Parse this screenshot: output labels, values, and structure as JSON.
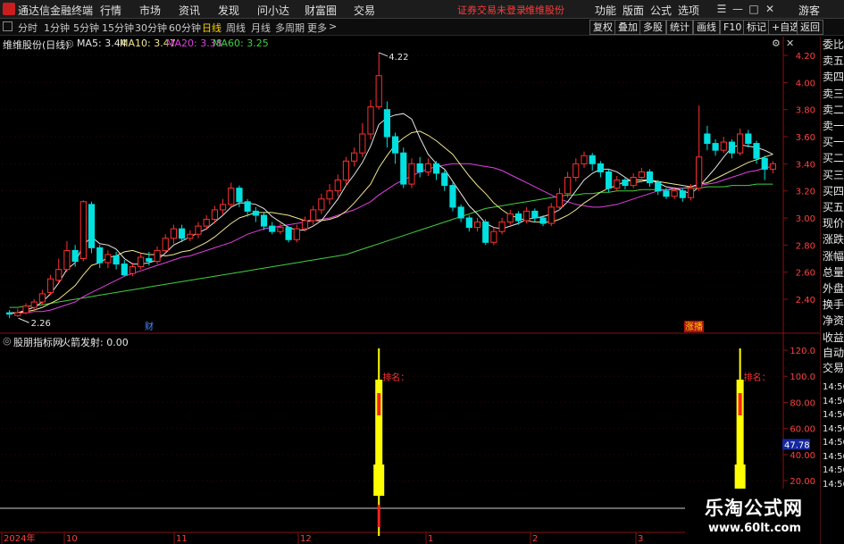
{
  "app": {
    "title": "通达信金融终端",
    "menu": [
      "行情",
      "市场",
      "资讯",
      "发现",
      "问小达",
      "财富圈",
      "交易"
    ],
    "status_text": "证券交易未登录",
    "stock_name": "维维股份",
    "right_menu": [
      "功能",
      "版面",
      "公式",
      "选项"
    ],
    "guest": "游客"
  },
  "toolbar": {
    "periods": [
      "分时",
      "1分钟",
      "5分钟",
      "15分钟",
      "30分钟",
      "60分钟",
      "日线",
      "周线",
      "月线",
      "多周期",
      "更多"
    ],
    "active_period": "日线",
    "right_buttons": [
      "复权",
      "叠加",
      "多股",
      "统计",
      "画线",
      "F10",
      "标记",
      "+自选",
      "返回"
    ]
  },
  "main_chart": {
    "title": "维维股份(日线)",
    "ma": [
      {
        "label": "MA5: 3.44",
        "color": "#e6e6e6"
      },
      {
        "label": "MA10: 3.47",
        "color": "#f0e68c"
      },
      {
        "label": "MA20: 3.38",
        "color": "#e040e0"
      },
      {
        "label": "MA60: 3.25",
        "color": "#40d040"
      }
    ],
    "high_label": "4.22",
    "low_label": "2.26",
    "y_ticks": [
      "4.20",
      "4.00",
      "3.80",
      "3.60",
      "3.40",
      "3.20",
      "3.00",
      "2.80",
      "2.60",
      "2.40"
    ],
    "markers": [
      "财",
      "涨播"
    ]
  },
  "sub_chart": {
    "title": "股朋指标网",
    "indicator": "火箭发射: 0.00",
    "label": "排名：",
    "y_ticks": [
      "120.0",
      "100.0",
      "80.00",
      "60.00",
      "40.00",
      "20.00"
    ],
    "current_value": "47.78"
  },
  "x_axis": [
    "2024年",
    "10",
    "11",
    "12",
    "1",
    "2",
    "3"
  ],
  "right_panel": [
    "委比",
    "卖五",
    "卖四",
    "卖三",
    "卖二",
    "卖一",
    "买一",
    "买二",
    "买三",
    "买四",
    "买五",
    "现价",
    "涨跌",
    "涨幅",
    "总量",
    "外盘",
    "换手",
    "净资",
    "收益",
    "自动",
    "交易",
    "14:56",
    "14:56",
    "14:56",
    "14:56",
    "14:56",
    "14:56",
    "14:56",
    "14:56"
  ],
  "watermark": {
    "title": "乐淘公式网",
    "url": "www.60lt.com"
  },
  "colors": {
    "up": "#ff3030",
    "down": "#00e0e0",
    "ma5": "#e6e6e6",
    "ma10": "#f0e68c",
    "ma20": "#e040e0",
    "ma60": "#40d040",
    "rocket": "#ffff00"
  },
  "chart_data": {
    "type": "candlestick",
    "y_range": [
      2.2,
      4.3
    ],
    "candles": [
      [
        2.3,
        2.29,
        2.32,
        2.26
      ],
      [
        2.28,
        2.3,
        2.33,
        2.27
      ],
      [
        2.3,
        2.35,
        2.37,
        2.29
      ],
      [
        2.34,
        2.38,
        2.4,
        2.32
      ],
      [
        2.38,
        2.44,
        2.47,
        2.36
      ],
      [
        2.45,
        2.55,
        2.58,
        2.43
      ],
      [
        2.54,
        2.62,
        2.7,
        2.52
      ],
      [
        2.62,
        2.76,
        2.83,
        2.6
      ],
      [
        2.76,
        2.68,
        2.8,
        2.64
      ],
      [
        2.7,
        3.12,
        3.13,
        2.68
      ],
      [
        3.1,
        2.78,
        3.12,
        2.74
      ],
      [
        2.78,
        2.67,
        2.8,
        2.63
      ],
      [
        2.67,
        2.73,
        2.76,
        2.63
      ],
      [
        2.72,
        2.66,
        2.75,
        2.62
      ],
      [
        2.66,
        2.58,
        2.69,
        2.57
      ],
      [
        2.59,
        2.64,
        2.67,
        2.57
      ],
      [
        2.64,
        2.71,
        2.74,
        2.62
      ],
      [
        2.7,
        2.68,
        2.75,
        2.65
      ],
      [
        2.68,
        2.76,
        2.79,
        2.66
      ],
      [
        2.76,
        2.85,
        2.88,
        2.74
      ],
      [
        2.85,
        2.92,
        2.95,
        2.81
      ],
      [
        2.92,
        2.85,
        2.95,
        2.82
      ],
      [
        2.85,
        2.88,
        2.91,
        2.83
      ],
      [
        2.88,
        2.94,
        2.97,
        2.85
      ],
      [
        2.94,
        2.99,
        3.02,
        2.91
      ],
      [
        2.99,
        3.06,
        3.09,
        2.96
      ],
      [
        3.06,
        3.1,
        3.14,
        3.02
      ],
      [
        3.1,
        3.22,
        3.26,
        3.08
      ],
      [
        3.22,
        3.12,
        3.24,
        3.08
      ],
      [
        3.12,
        3.05,
        3.14,
        3.01
      ],
      [
        3.05,
        3.02,
        3.08,
        2.97
      ],
      [
        3.02,
        2.94,
        3.04,
        2.91
      ],
      [
        2.94,
        2.9,
        2.97,
        2.88
      ],
      [
        2.9,
        2.93,
        2.96,
        2.88
      ],
      [
        2.93,
        2.84,
        2.94,
        2.82
      ],
      [
        2.84,
        2.92,
        2.95,
        2.82
      ],
      [
        2.92,
        2.98,
        3.01,
        2.9
      ],
      [
        2.98,
        3.06,
        3.09,
        2.95
      ],
      [
        3.06,
        3.14,
        3.18,
        3.03
      ],
      [
        3.14,
        3.2,
        3.25,
        3.1
      ],
      [
        3.2,
        3.28,
        3.32,
        3.16
      ],
      [
        3.28,
        3.42,
        3.45,
        3.24
      ],
      [
        3.42,
        3.48,
        3.52,
        3.38
      ],
      [
        3.48,
        3.62,
        3.7,
        3.45
      ],
      [
        3.62,
        3.82,
        3.87,
        3.58
      ],
      [
        3.82,
        4.05,
        4.22,
        3.8
      ],
      [
        3.8,
        3.6,
        3.86,
        3.52
      ],
      [
        3.6,
        3.48,
        3.63,
        3.4
      ],
      [
        3.48,
        3.25,
        3.52,
        3.22
      ],
      [
        3.25,
        3.4,
        3.44,
        3.22
      ],
      [
        3.4,
        3.34,
        3.45,
        3.3
      ],
      [
        3.34,
        3.4,
        3.44,
        3.31
      ],
      [
        3.4,
        3.33,
        3.42,
        3.28
      ],
      [
        3.33,
        3.24,
        3.35,
        3.2
      ],
      [
        3.24,
        3.08,
        3.26,
        3.05
      ],
      [
        3.08,
        3.0,
        3.1,
        2.97
      ],
      [
        3.0,
        2.93,
        3.02,
        2.9
      ],
      [
        2.93,
        2.97,
        3.0,
        2.9
      ],
      [
        2.97,
        2.82,
        2.99,
        2.8
      ],
      [
        2.82,
        2.9,
        2.93,
        2.8
      ],
      [
        2.9,
        2.97,
        3.0,
        2.88
      ],
      [
        2.97,
        3.03,
        3.06,
        2.95
      ],
      [
        3.03,
        2.98,
        3.05,
        2.95
      ],
      [
        2.98,
        3.05,
        3.08,
        2.96
      ],
      [
        3.05,
        3.0,
        3.07,
        2.97
      ],
      [
        3.0,
        2.96,
        3.02,
        2.94
      ],
      [
        2.96,
        3.08,
        3.11,
        2.94
      ],
      [
        3.08,
        3.18,
        3.22,
        3.06
      ],
      [
        3.18,
        3.3,
        3.34,
        3.15
      ],
      [
        3.3,
        3.4,
        3.44,
        3.27
      ],
      [
        3.4,
        3.46,
        3.49,
        3.37
      ],
      [
        3.46,
        3.4,
        3.48,
        3.35
      ],
      [
        3.4,
        3.34,
        3.42,
        3.3
      ],
      [
        3.34,
        3.22,
        3.36,
        3.19
      ],
      [
        3.22,
        3.28,
        3.31,
        3.2
      ],
      [
        3.28,
        3.24,
        3.3,
        3.21
      ],
      [
        3.24,
        3.3,
        3.33,
        3.22
      ],
      [
        3.3,
        3.34,
        3.37,
        3.27
      ],
      [
        3.34,
        3.26,
        3.36,
        3.23
      ],
      [
        3.26,
        3.2,
        3.28,
        3.17
      ],
      [
        3.2,
        3.16,
        3.22,
        3.14
      ],
      [
        3.16,
        3.2,
        3.23,
        3.14
      ],
      [
        3.2,
        3.15,
        3.22,
        3.12
      ],
      [
        3.15,
        3.22,
        3.25,
        3.13
      ],
      [
        3.22,
        3.45,
        3.83,
        3.2
      ],
      [
        3.62,
        3.55,
        3.68,
        3.5
      ],
      [
        3.55,
        3.5,
        3.58,
        3.46
      ],
      [
        3.5,
        3.56,
        3.6,
        3.48
      ],
      [
        3.56,
        3.48,
        3.58,
        3.44
      ],
      [
        3.48,
        3.62,
        3.66,
        3.46
      ],
      [
        3.62,
        3.55,
        3.65,
        3.52
      ],
      [
        3.55,
        3.44,
        3.57,
        3.4
      ],
      [
        3.44,
        3.36,
        3.46,
        3.28
      ],
      [
        3.36,
        3.4,
        3.42,
        3.33
      ]
    ],
    "ma5": [
      2.3,
      2.3,
      2.32,
      2.34,
      2.38,
      2.44,
      2.52,
      2.62,
      2.67,
      2.8,
      2.86,
      2.81,
      2.8,
      2.77,
      2.7,
      2.66,
      2.66,
      2.67,
      2.69,
      2.74,
      2.8,
      2.83,
      2.86,
      2.89,
      2.92,
      2.97,
      3.02,
      3.08,
      3.11,
      3.11,
      3.1,
      3.07,
      3.01,
      2.97,
      2.93,
      2.91,
      2.91,
      2.94,
      2.98,
      3.06,
      3.14,
      3.24,
      3.32,
      3.41,
      3.53,
      3.69,
      3.74,
      3.76,
      3.77,
      3.73,
      3.59,
      3.47,
      3.4,
      3.36,
      3.27,
      3.18,
      3.09,
      3.03,
      2.96,
      2.93,
      2.92,
      2.94,
      2.96,
      2.99,
      3.0,
      3.01,
      3.03,
      3.06,
      3.12,
      3.2,
      3.28,
      3.33,
      3.36,
      3.36,
      3.34,
      3.3,
      3.26,
      3.27,
      3.28,
      3.26,
      3.23,
      3.22,
      3.2,
      3.18,
      3.23,
      3.3,
      3.37,
      3.45,
      3.52,
      3.54,
      3.53,
      3.52,
      3.5,
      3.47
    ],
    "ma10": [
      2.3,
      2.3,
      2.31,
      2.32,
      2.34,
      2.37,
      2.4,
      2.45,
      2.5,
      2.58,
      2.65,
      2.67,
      2.71,
      2.72,
      2.75,
      2.76,
      2.74,
      2.73,
      2.73,
      2.72,
      2.73,
      2.75,
      2.76,
      2.79,
      2.82,
      2.86,
      2.91,
      2.96,
      3.0,
      3.02,
      3.04,
      3.04,
      3.04,
      3.03,
      3.02,
      3.0,
      2.98,
      2.98,
      2.98,
      2.99,
      3.01,
      3.05,
      3.11,
      3.18,
      3.25,
      3.37,
      3.46,
      3.54,
      3.59,
      3.63,
      3.64,
      3.61,
      3.57,
      3.52,
      3.47,
      3.39,
      3.31,
      3.24,
      3.18,
      3.11,
      3.06,
      3.02,
      3.0,
      2.98,
      2.97,
      2.97,
      2.97,
      2.99,
      3.02,
      3.06,
      3.11,
      3.15,
      3.19,
      3.22,
      3.24,
      3.27,
      3.28,
      3.28,
      3.28,
      3.27,
      3.26,
      3.25,
      3.24,
      3.23,
      3.25,
      3.26,
      3.29,
      3.32,
      3.35,
      3.38,
      3.41,
      3.43,
      3.45,
      3.47
    ],
    "ma20": [
      2.3,
      2.3,
      2.3,
      2.31,
      2.31,
      2.32,
      2.34,
      2.36,
      2.38,
      2.42,
      2.45,
      2.48,
      2.51,
      2.54,
      2.57,
      2.59,
      2.61,
      2.63,
      2.65,
      2.67,
      2.69,
      2.71,
      2.72,
      2.74,
      2.76,
      2.78,
      2.8,
      2.82,
      2.85,
      2.88,
      2.9,
      2.92,
      2.93,
      2.94,
      2.95,
      2.96,
      2.97,
      2.98,
      2.99,
      3.0,
      3.02,
      3.04,
      3.06,
      3.09,
      3.12,
      3.17,
      3.21,
      3.25,
      3.28,
      3.31,
      3.34,
      3.36,
      3.38,
      3.39,
      3.4,
      3.4,
      3.4,
      3.39,
      3.38,
      3.37,
      3.35,
      3.32,
      3.29,
      3.26,
      3.23,
      3.2,
      3.17,
      3.14,
      3.12,
      3.1,
      3.09,
      3.08,
      3.08,
      3.09,
      3.1,
      3.12,
      3.14,
      3.16,
      3.18,
      3.2,
      3.21,
      3.22,
      3.22,
      3.23,
      3.24,
      3.25,
      3.26,
      3.28,
      3.3,
      3.32,
      3.34,
      3.35,
      3.37,
      3.38
    ],
    "ma60": [
      2.34,
      2.34,
      2.35,
      2.35,
      2.36,
      2.37,
      2.38,
      2.39,
      2.4,
      2.41,
      2.42,
      2.43,
      2.44,
      2.45,
      2.46,
      2.47,
      2.48,
      2.49,
      2.5,
      2.51,
      2.52,
      2.53,
      2.54,
      2.55,
      2.56,
      2.57,
      2.58,
      2.59,
      2.6,
      2.61,
      2.62,
      2.63,
      2.64,
      2.65,
      2.66,
      2.67,
      2.68,
      2.69,
      2.7,
      2.71,
      2.72,
      2.73,
      2.75,
      2.77,
      2.79,
      2.81,
      2.83,
      2.85,
      2.87,
      2.89,
      2.91,
      2.93,
      2.95,
      2.97,
      2.99,
      3.01,
      3.03,
      3.05,
      3.07,
      3.08,
      3.09,
      3.1,
      3.11,
      3.12,
      3.13,
      3.14,
      3.15,
      3.16,
      3.17,
      3.17,
      3.18,
      3.18,
      3.19,
      3.19,
      3.2,
      3.2,
      3.2,
      3.21,
      3.21,
      3.21,
      3.21,
      3.21,
      3.22,
      3.22,
      3.22,
      3.23,
      3.23,
      3.23,
      3.24,
      3.24,
      3.24,
      3.25,
      3.25,
      3.25
    ],
    "signals": [
      45,
      89
    ]
  }
}
